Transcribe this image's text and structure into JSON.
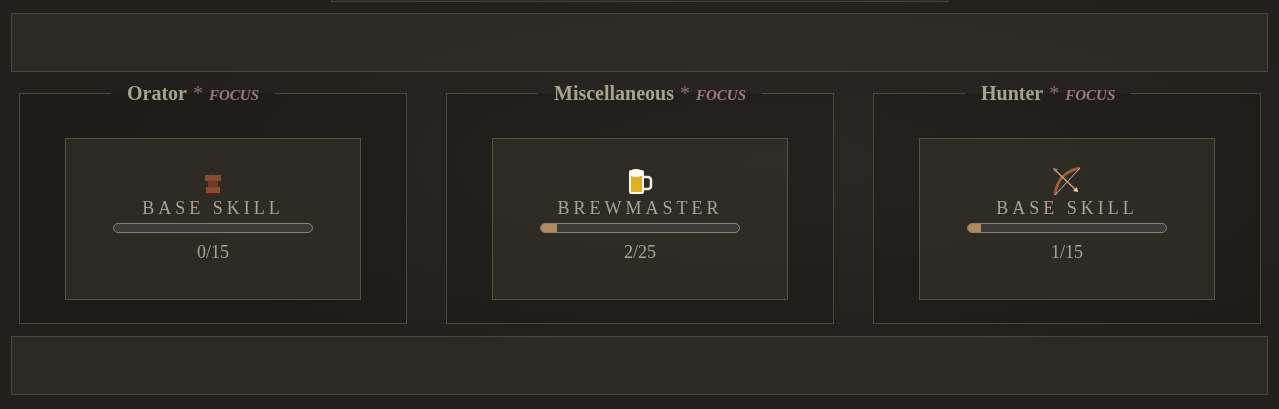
{
  "skill_groups": [
    {
      "title": "Orator",
      "marker": "*",
      "tag": "FOCUS",
      "skill": {
        "name": "BASE SKILL",
        "level": 0,
        "progress": "0/15"
      }
    },
    {
      "title": "Miscellaneous",
      "marker": "*",
      "tag": "FOCUS",
      "skill": {
        "name": "BREWMASTER",
        "level": 0.08,
        "progress": "2/25"
      }
    },
    {
      "title": "Hunter",
      "marker": "*",
      "tag": "FOCUS",
      "skill": {
        "name": "BASE SKILL",
        "level": 0.067,
        "progress": "1/15"
      }
    }
  ]
}
